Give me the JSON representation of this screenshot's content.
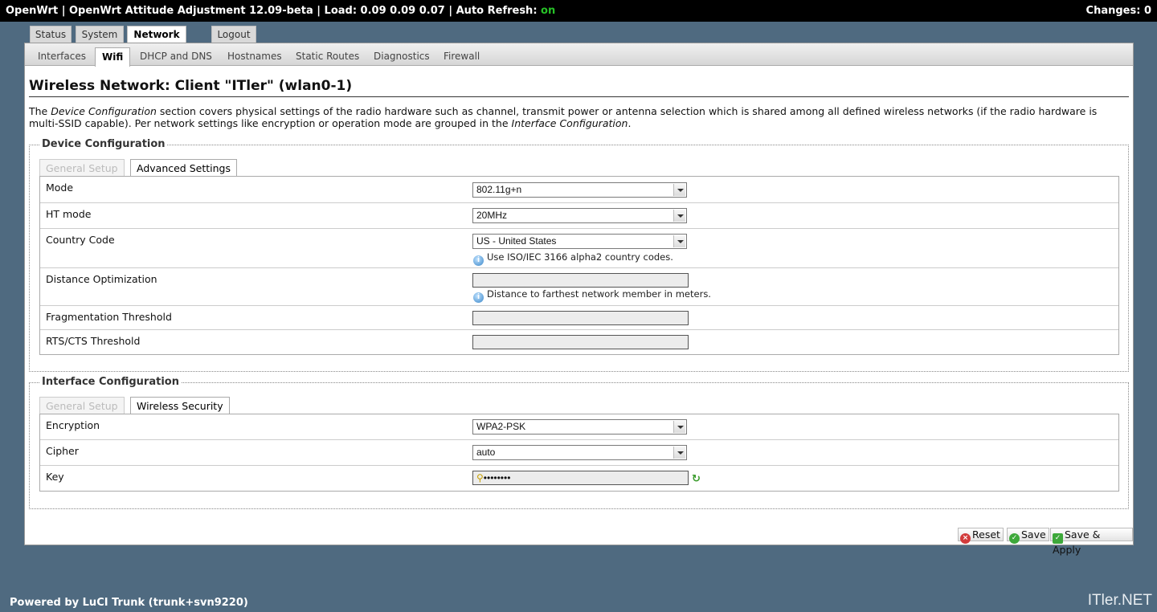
{
  "topbar": {
    "prefix": "OpenWrt | OpenWrt Attitude Adjustment 12.09-beta | Load: 0.09 0.09 0.07 | Auto Refresh: ",
    "auto_refresh": "on",
    "changes": "Changes: 0"
  },
  "main_tabs": [
    "Status",
    "System",
    "Network",
    "Logout"
  ],
  "sub_tabs": [
    "Interfaces",
    "Wifi",
    "DHCP and DNS",
    "Hostnames",
    "Static Routes",
    "Diagnostics",
    "Firewall"
  ],
  "page": {
    "title": "Wireless Network: Client \"ITler\" (wlan0-1)",
    "desc": {
      "p1": "The ",
      "i1": "Device Configuration",
      "p2": " section covers physical settings of the radio hardware such as channel, transmit power or antenna selection which is shared among all defined wireless networks (if the radio hardware is multi-SSID capable). Per network settings like encryption or operation mode are grouped in the ",
      "i2": "Interface Configuration",
      "p3": "."
    }
  },
  "device_config": {
    "legend": "Device Configuration",
    "tabs": [
      "General Setup",
      "Advanced Settings"
    ],
    "mode": {
      "label": "Mode",
      "value": "802.11g+n"
    },
    "ht_mode": {
      "label": "HT mode",
      "value": "20MHz"
    },
    "country": {
      "label": "Country Code",
      "value": "US - United States",
      "hint": "Use ISO/IEC 3166 alpha2 country codes."
    },
    "distance": {
      "label": "Distance Optimization",
      "value": "",
      "hint": "Distance to farthest network member in meters."
    },
    "frag": {
      "label": "Fragmentation Threshold",
      "value": ""
    },
    "rts": {
      "label": "RTS/CTS Threshold",
      "value": ""
    }
  },
  "iface_config": {
    "legend": "Interface Configuration",
    "tabs": [
      "General Setup",
      "Wireless Security"
    ],
    "encryption": {
      "label": "Encryption",
      "value": "WPA2-PSK"
    },
    "cipher": {
      "label": "Cipher",
      "value": "auto"
    },
    "key": {
      "label": "Key",
      "value": "••••••••"
    }
  },
  "buttons": {
    "reset": "Reset",
    "save": "Save",
    "save_apply": "Save & Apply"
  },
  "footer": "Powered by LuCI Trunk (trunk+svn9220)",
  "watermark": "ITler.NET",
  "icons": {
    "info": "info-icon",
    "key": "key-icon",
    "refresh": "refresh-icon",
    "reset": "reset-icon",
    "save": "save-icon",
    "apply": "apply-icon"
  },
  "colors": {
    "background": "#4f6a80",
    "topbar": "#000000",
    "on": "#27c227"
  }
}
